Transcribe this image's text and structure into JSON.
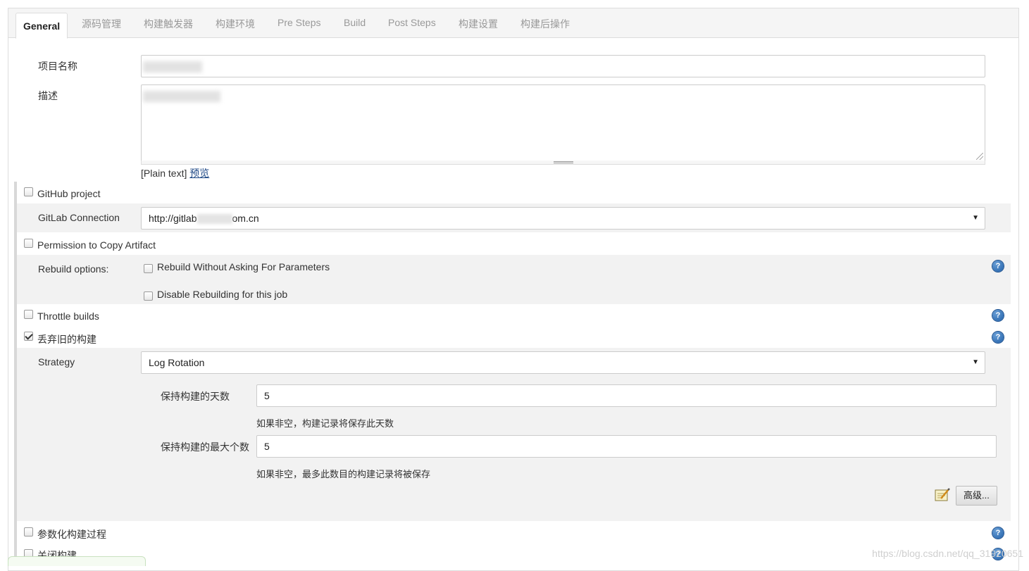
{
  "tabs": [
    {
      "label": "General",
      "active": true
    },
    {
      "label": "源码管理"
    },
    {
      "label": "构建触发器"
    },
    {
      "label": "构建环境"
    },
    {
      "label": "Pre Steps"
    },
    {
      "label": "Build"
    },
    {
      "label": "Post Steps"
    },
    {
      "label": "构建设置"
    },
    {
      "label": "构建后操作"
    }
  ],
  "general": {
    "project_name_label": "项目名称",
    "description_label": "描述",
    "plain_text": "[Plain text]",
    "preview_link": "预览"
  },
  "options": {
    "github_project": {
      "label": "GitHub project",
      "checked": false
    },
    "gitlab_connection": {
      "label": "GitLab Connection",
      "value_start": "http://gitlab",
      "value_end": "om.cn"
    },
    "copy_artifact": {
      "label": "Permission to Copy Artifact",
      "checked": false
    },
    "rebuild": {
      "label": "Rebuild options:",
      "without_asking": {
        "label": "Rebuild Without Asking For Parameters",
        "checked": false
      },
      "disable": {
        "label": "Disable Rebuilding for this job",
        "checked": false
      }
    },
    "throttle": {
      "label": "Throttle builds",
      "checked": false
    },
    "discard_old": {
      "label": "丢弃旧的构建",
      "checked": true
    },
    "strategy": {
      "label": "Strategy",
      "value": "Log Rotation",
      "days_label": "保持构建的天数",
      "days_value": "5",
      "days_hint": "如果非空，构建记录将保存此天数",
      "max_label": "保持构建的最大个数",
      "max_value": "5",
      "max_hint": "如果非空，最多此数目的构建记录将被保存",
      "advanced_button": "高级..."
    },
    "parameterized": {
      "label": "参数化构建过程",
      "checked": false
    },
    "disable_build": {
      "label": "关闭构建",
      "checked": false
    }
  },
  "icons": {
    "help": "?",
    "caret": "▼"
  },
  "watermark": "https://blog.csdn.net/qq_31920651",
  "colors": {
    "help_blue": "#1f5fa8",
    "band": "#f2f2f2",
    "link": "#204a87"
  }
}
